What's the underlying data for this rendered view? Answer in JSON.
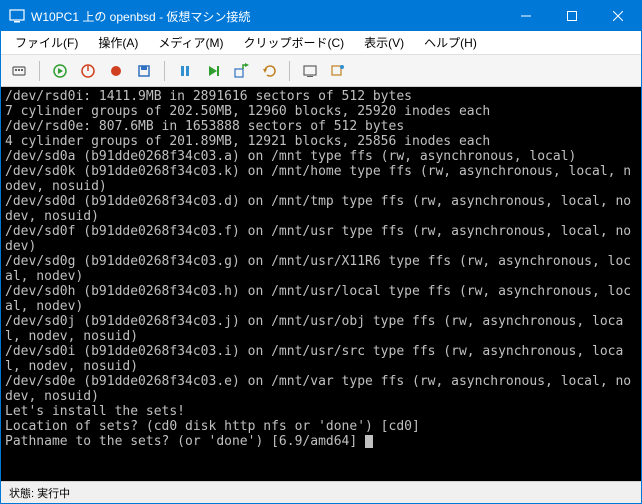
{
  "titlebar": {
    "title": "W10PC1 上の openbsd - 仮想マシン接続"
  },
  "menubar": {
    "file": "ファイル(F)",
    "action": "操作(A)",
    "media": "メディア(M)",
    "clipboard": "クリップボード(C)",
    "view": "表示(V)",
    "help": "ヘルプ(H)"
  },
  "terminal": {
    "lines": [
      "/dev/rsd0i: 1411.9MB in 2891616 sectors of 512 bytes",
      "7 cylinder groups of 202.50MB, 12960 blocks, 25920 inodes each",
      "/dev/rsd0e: 807.6MB in 1653888 sectors of 512 bytes",
      "4 cylinder groups of 201.89MB, 12921 blocks, 25856 inodes each",
      "/dev/sd0a (b91dde0268f34c03.a) on /mnt type ffs (rw, asynchronous, local)",
      "/dev/sd0k (b91dde0268f34c03.k) on /mnt/home type ffs (rw, asynchronous, local, nodev, nosuid)",
      "/dev/sd0d (b91dde0268f34c03.d) on /mnt/tmp type ffs (rw, asynchronous, local, nodev, nosuid)",
      "/dev/sd0f (b91dde0268f34c03.f) on /mnt/usr type ffs (rw, asynchronous, local, nodev)",
      "/dev/sd0g (b91dde0268f34c03.g) on /mnt/usr/X11R6 type ffs (rw, asynchronous, local, nodev)",
      "/dev/sd0h (b91dde0268f34c03.h) on /mnt/usr/local type ffs (rw, asynchronous, local, nodev)",
      "/dev/sd0j (b91dde0268f34c03.j) on /mnt/usr/obj type ffs (rw, asynchronous, local, nodev, nosuid)",
      "/dev/sd0i (b91dde0268f34c03.i) on /mnt/usr/src type ffs (rw, asynchronous, local, nodev, nosuid)",
      "/dev/sd0e (b91dde0268f34c03.e) on /mnt/var type ffs (rw, asynchronous, local, nodev, nosuid)",
      "",
      "Let's install the sets!",
      "Location of sets? (cd0 disk http nfs or 'done') [cd0]",
      "Pathname to the sets? (or 'done') [6.9/amd64] "
    ]
  },
  "statusbar": {
    "label": "状態:",
    "value": "実行中"
  },
  "colors": {
    "accent": "#0078d7",
    "terminal_bg": "#000000",
    "terminal_fg": "#c0c0c0"
  }
}
